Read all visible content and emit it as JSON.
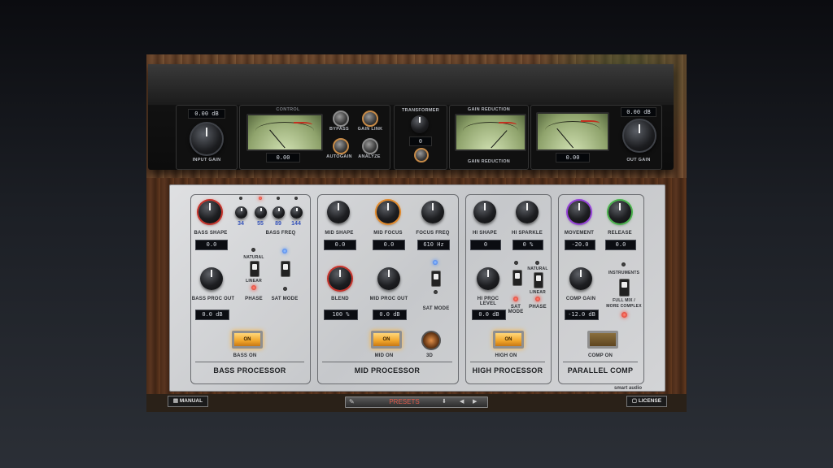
{
  "top_rack": {
    "input_value": "0.00 dB",
    "input_label": "INPUT GAIN",
    "control_label": "CONTROL",
    "meter_value": "0.00",
    "bypass_label": "BYPASS",
    "gain_link_label": "GAIN LINK",
    "autogain_label": "AUTOGAIN",
    "analyze_label": "ANALYZE",
    "transformer_label": "TRANSFORMER",
    "transformer_value": "0",
    "gr_label_top": "GAIN REDUCTION",
    "gr_label_bottom": "GAIN REDUCTION",
    "out_value": "0.00 dB",
    "out_meter_value": "0.00",
    "out_label": "OUT GAIN"
  },
  "bass": {
    "title": "BASS PROCESSOR",
    "shape_label": "BASS SHAPE",
    "shape_value": "0.0",
    "freq_label": "BASS FREQ",
    "freqs": [
      "34",
      "55",
      "89",
      "144"
    ],
    "natural_label": "NATURAL",
    "linear_label": "LINEAR",
    "proc_out_label": "BASS PROC OUT",
    "proc_out_value": "0.0 dB",
    "phase_label": "PHASE",
    "sat_mode_label": "SAT MODE",
    "on_label": "ON",
    "bass_on_label": "BASS ON"
  },
  "mid": {
    "title": "MID PROCESSOR",
    "shape_label": "MID SHAPE",
    "shape_value": "0.0",
    "focus_label": "MID FOCUS",
    "focus_value": "0.0",
    "focus_freq_label": "FOCUS FREQ",
    "focus_freq_value": "610 Hz",
    "blend_label": "BLEND",
    "blend_value": "100 %",
    "proc_out_label": "MID PROC OUT",
    "proc_out_value": "0.0 dB",
    "sat_mode_label": "SAT MODE",
    "on_label": "ON",
    "mid_on_label": "MID ON",
    "3d_label": "3D"
  },
  "high": {
    "title": "HIGH PROCESSOR",
    "shape_label": "HI SHAPE",
    "shape_value": "0",
    "sparkle_label": "HI SPARKLE",
    "sparkle_value": "0 %",
    "natural_label": "NATURAL",
    "linear_label": "LINEAR",
    "proc_level_label": "HI PROC LEVEL",
    "proc_level_value": "0.0 dB",
    "sat_mode_label": "SAT MODE",
    "phase_label": "PHASE",
    "on_label": "ON",
    "high_on_label": "HIGH ON"
  },
  "comp": {
    "title": "PARALLEL COMP",
    "movement_label": "MOVEMENT",
    "movement_value": "-20.0",
    "release_label": "RELEASE",
    "release_value": "0.0",
    "instruments_label": "INSTRUMENTS",
    "full_mix_label": "FULL MIX /",
    "more_complex_label": "MORE COMPLEX",
    "gain_label": "COMP GAIN",
    "gain_value": "-12.0 dB",
    "comp_on_label": "COMP ON"
  },
  "brand": {
    "name": "smart audio"
  },
  "bottom": {
    "manual_label": "MANUAL",
    "presets_label": "PRESETS",
    "license_label": "LICENSE"
  },
  "colors": {
    "on_button": "#f0a52a",
    "led_red": "#d62a1e",
    "led_blue": "#2f6ee5",
    "freq_text": "#3552b8"
  }
}
